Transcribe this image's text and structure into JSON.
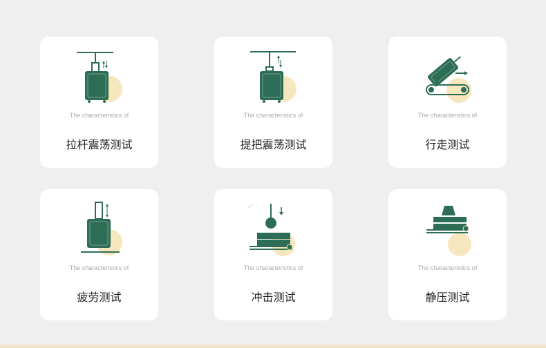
{
  "colors": {
    "background": "#efefef",
    "card": "#ffffff",
    "green": "#2e6d55",
    "accent_circle": "#f7e7bf",
    "caption": "#a9a9a9",
    "title": "#222222"
  },
  "tests": [
    {
      "icon": "suitcase-handle-vibration-icon",
      "caption": "The characteristics of",
      "title": "拉杆震荡测试"
    },
    {
      "icon": "suitcase-grip-vibration-icon",
      "caption": "The characteristics of",
      "title": "提把震荡测试"
    },
    {
      "icon": "suitcase-walking-conveyor-icon",
      "caption": "The characteristics of",
      "title": "行走测试"
    },
    {
      "icon": "suitcase-fatigue-icon",
      "caption": "The characteristics of",
      "title": "疲劳测试"
    },
    {
      "icon": "suitcase-impact-icon",
      "caption": "The characteristics of",
      "title": "冲击测试"
    },
    {
      "icon": "suitcase-compression-icon",
      "caption": "The characteristics of",
      "title": "静压测试"
    }
  ]
}
